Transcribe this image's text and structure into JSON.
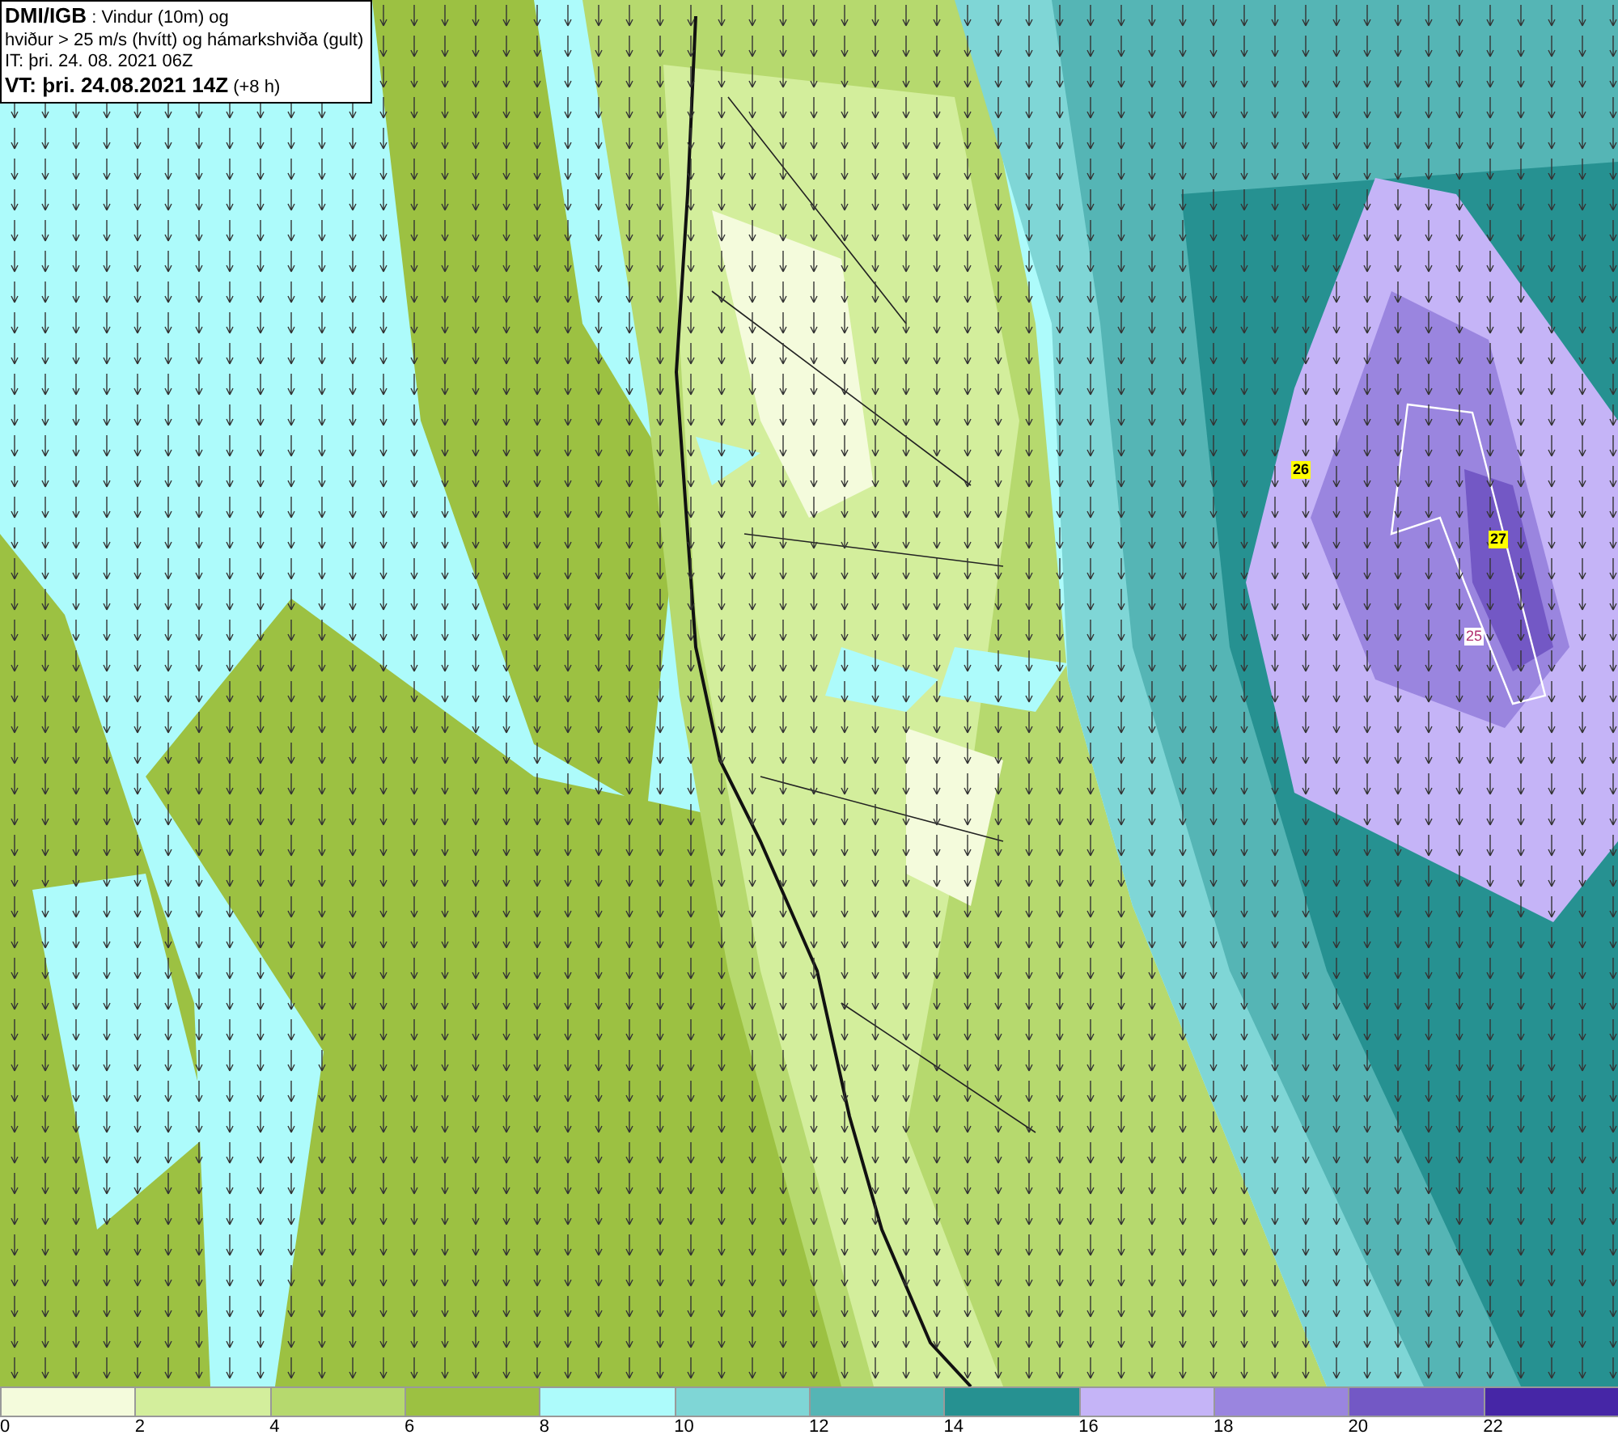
{
  "header": {
    "source": "DMI/IGB",
    "title_rest": " : Vindur (10m) og",
    "subtitle": "hviður > 25 m/s (hvítt) og hámarkshviða (gult)",
    "issue_time": "IT: þri. 24. 08. 2021 06Z",
    "valid_time": "VT: þri. 24.08.2021 14Z",
    "lead": " (+8 h)"
  },
  "map_labels": [
    {
      "text": "26",
      "kind": "max"
    },
    {
      "text": "27",
      "kind": "max"
    },
    {
      "text": "25",
      "kind": "gust"
    }
  ],
  "legend": {
    "bins": [
      {
        "color": "#f4fbdc"
      },
      {
        "color": "#d3ee9c"
      },
      {
        "color": "#b6d96e"
      },
      {
        "color": "#9cc142"
      },
      {
        "color": "#adfbfb"
      },
      {
        "color": "#7fd6d6"
      },
      {
        "color": "#55b5b5"
      },
      {
        "color": "#269191"
      },
      {
        "color": "#c5b4f7"
      },
      {
        "color": "#9a85df"
      },
      {
        "color": "#7358c5"
      },
      {
        "color": "#4626a6"
      }
    ],
    "ticks": [
      "0",
      "2",
      "4",
      "6",
      "8",
      "10",
      "12",
      "14",
      "16",
      "18",
      "20",
      "22"
    ]
  }
}
